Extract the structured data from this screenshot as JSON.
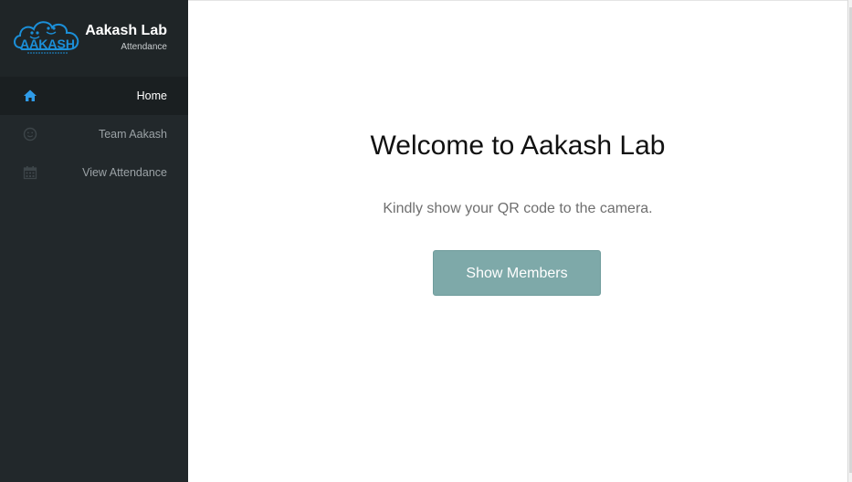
{
  "brand": {
    "logo_text": "AAKASH",
    "title": "Aakash Lab",
    "subtitle": "Attendance"
  },
  "sidebar": {
    "items": [
      {
        "label": "Home",
        "icon": "home-icon",
        "active": true
      },
      {
        "label": "Team Aakash",
        "icon": "smile-icon",
        "active": false
      },
      {
        "label": "View Attendance",
        "icon": "calendar-icon",
        "active": false
      }
    ]
  },
  "main": {
    "heading": "Welcome to Aakash Lab",
    "instruction": "Kindly show your QR code to the camera.",
    "button_label": "Show Members"
  },
  "colors": {
    "sidebar_bg": "#22282b",
    "active_item_bg": "#1a1f21",
    "home_icon": "#2f9be8",
    "button_bg": "#7ea9a9",
    "logo_blue": "#1b8fd8"
  }
}
